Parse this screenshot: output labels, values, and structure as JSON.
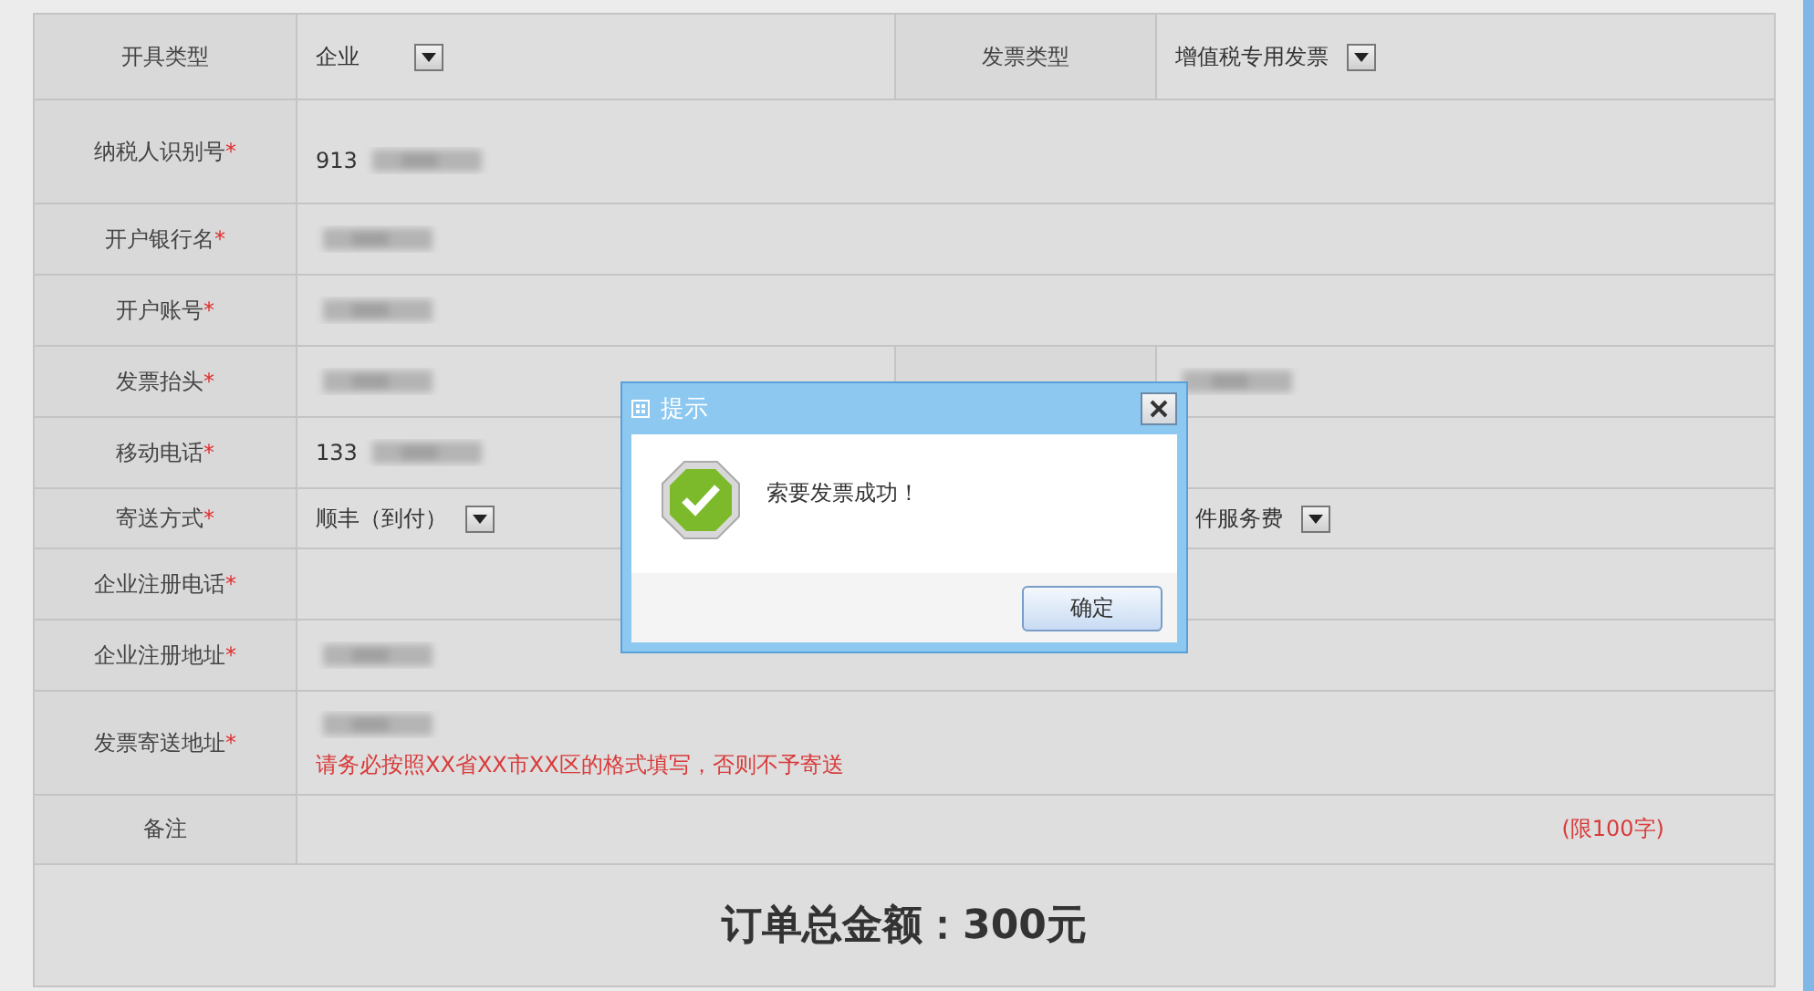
{
  "form": {
    "rows": [
      {
        "label": "开具类型",
        "value": {
          "kind": "select",
          "text": "企业"
        },
        "label2": "发票类型",
        "value2": {
          "kind": "select",
          "text": "增值税专用发票"
        }
      },
      {
        "label": "纳税人识别号",
        "mark": "*",
        "value": {
          "kind": "blurred",
          "prefix": "913"
        }
      },
      {
        "label": "开户银行名",
        "mark": "*",
        "value": {
          "kind": "blurred"
        }
      },
      {
        "label": "开户账号",
        "mark": "*",
        "value": {
          "kind": "blurred"
        }
      },
      {
        "label": "发票抬头",
        "mark": "*",
        "value": {
          "kind": "blurred"
        },
        "value2": {
          "kind": "blurred"
        }
      },
      {
        "label": "移动电话",
        "mark": "*",
        "value": {
          "kind": "blurred",
          "prefix": "133"
        }
      },
      {
        "label": "寄送方式",
        "mark": "*",
        "value": {
          "kind": "select",
          "text": "顺丰（到付）"
        },
        "extra": {
          "kind": "select",
          "text": "件服务费"
        }
      },
      {
        "label": "企业注册电话",
        "mark": "*",
        "value": {
          "kind": "empty"
        }
      },
      {
        "label": "企业注册地址",
        "mark": "*",
        "value": {
          "kind": "blurred"
        }
      },
      {
        "label": "发票寄送地址",
        "mark": "*",
        "value": {
          "kind": "address",
          "hint": "请务必按照XX省XX市XX区的格式填写，否则不予寄送"
        }
      },
      {
        "label": "备注",
        "value": {
          "kind": "note",
          "hint": "(限100字)"
        }
      }
    ],
    "total": "订单总金额：300元"
  },
  "dialog": {
    "title": "提示",
    "message": "索要发票成功！",
    "button": "确定"
  }
}
